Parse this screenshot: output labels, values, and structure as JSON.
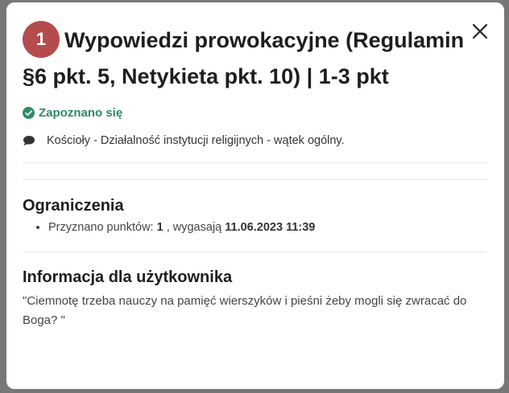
{
  "modal": {
    "badge": "1",
    "title": "Wypowiedzi prowokacyjne (Regulamin §6 pkt. 5, Netykieta pkt. 10) | 1-3 pkt",
    "status": "Zapoznano się",
    "status_icon": "check-circle-icon",
    "status_color": "#2e8b63",
    "thread_icon": "comment-icon",
    "thread": "Kościoły - Działalność instytucji religijnych - wątek ogólny.",
    "close_icon": "close-icon",
    "badge_color": "#b54b4d"
  },
  "limits": {
    "heading": "Ograniczenia",
    "item_prefix": "Przyznano punktów:",
    "points": "1",
    "item_mid": ", wygasają",
    "expires": "11.06.2023 11:39"
  },
  "info": {
    "heading": "Informacja dla użytkownika",
    "text": "\"Ciemnotę trzeba nauczy na pamięć wierszyków i pieśni żeby mogli się zwracać do Boga? \""
  }
}
